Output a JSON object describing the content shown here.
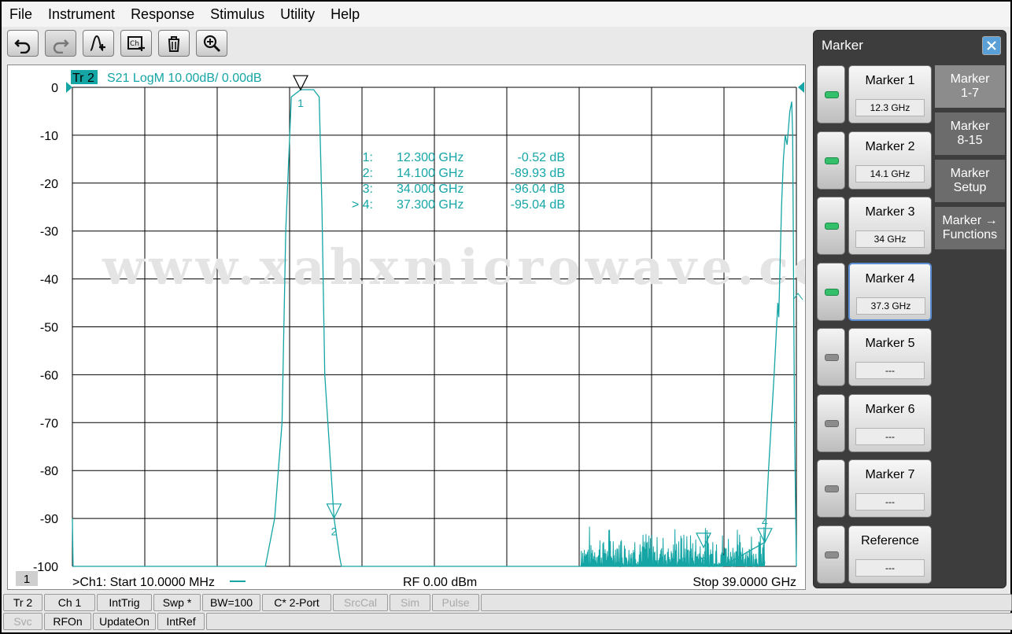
{
  "menu": [
    "File",
    "Instrument",
    "Response",
    "Stimulus",
    "Utility",
    "Help"
  ],
  "toolbar": [
    {
      "name": "undo-button",
      "icon": "undo-icon"
    },
    {
      "name": "redo-button",
      "icon": "redo-icon",
      "disabled": true
    },
    {
      "name": "add-marker-button",
      "icon": "marker-add-icon"
    },
    {
      "name": "add-channel-button",
      "icon": "channel-add-icon"
    },
    {
      "name": "delete-button",
      "icon": "trash-icon"
    },
    {
      "name": "zoom-button",
      "icon": "zoom-in-icon"
    }
  ],
  "trace": {
    "label": "Tr 2",
    "info": "S21 LogM 10.00dB/  0.00dB",
    "color": "#15a5a5"
  },
  "axis": {
    "y_ticks": [
      "0",
      "-10",
      "-20",
      "-30",
      "-40",
      "-50",
      "-60",
      "-70",
      "-80",
      "-90",
      "-100"
    ]
  },
  "chart_data": {
    "type": "line",
    "x_start_ghz": 0.01,
    "x_stop_ghz": 39.0,
    "ylim": [
      -100,
      0
    ],
    "y_step": 10,
    "series": [
      {
        "x": [
          0.01,
          0.05,
          0.1,
          10.4,
          10.9,
          11.3,
          11.5,
          11.8,
          12.3,
          13.0,
          13.3,
          13.45,
          13.6,
          14.1,
          14.4,
          14.5,
          27.4,
          35.0,
          37.3,
          37.5,
          37.8,
          38.0,
          38.05,
          38.2,
          38.3,
          38.4,
          38.5,
          38.65,
          38.75,
          38.8,
          38.9,
          39.0
        ],
        "y": [
          -90,
          -100,
          -100,
          -100,
          -90,
          -70,
          -30,
          -2,
          -0.5,
          -0.5,
          -2,
          -25,
          -60,
          -90,
          -98,
          -100,
          -100,
          -100,
          -95,
          -80,
          -60,
          -45,
          -48,
          -25,
          -15,
          -10,
          -12,
          -5,
          -3,
          -10,
          -70,
          -100
        ]
      }
    ],
    "noise_floor": {
      "x_from_ghz": 27.4,
      "x_to_ghz": 37.3,
      "min_db": -100,
      "max_db": -91
    }
  },
  "markers": [
    {
      "num": "1",
      "freq": "12.300  GHz",
      "val": "-0.52 dB",
      "x_ghz": 12.3,
      "y_db": -0.52,
      "active": false
    },
    {
      "num": "2",
      "freq": "14.100  GHz",
      "val": "-89.93 dB",
      "x_ghz": 14.1,
      "y_db": -89.93,
      "active": false
    },
    {
      "num": "3",
      "freq": "34.000  GHz",
      "val": "-96.04 dB",
      "x_ghz": 34.0,
      "y_db": -96.04,
      "active": false
    },
    {
      "num": "4",
      "freq": "37.300  GHz",
      "val": "-95.04 dB",
      "x_ghz": 37.3,
      "y_db": -95.04,
      "active": true
    }
  ],
  "marker_readout_prefix": [
    "1:",
    "2:",
    "3:",
    "> 4:"
  ],
  "watermark": "www.xahxmicrowave.com",
  "footer": {
    "channel_badge": "1",
    "start": ">Ch1:  Start   10.0000 MHz",
    "power": "RF     0.00 dBm",
    "stop": "Stop  39.0000 GHz"
  },
  "status_row1": [
    {
      "label": "Tr 2",
      "w": 50
    },
    {
      "label": "Ch 1",
      "w": 65
    },
    {
      "label": "IntTrig",
      "w": 70
    },
    {
      "label": "Swp *",
      "w": 60
    },
    {
      "label": "BW=100",
      "w": 74
    },
    {
      "label": "C* 2-Port",
      "w": 88
    },
    {
      "label": "SrcCal",
      "w": 70,
      "dim": true
    },
    {
      "label": "Sim",
      "w": 52,
      "dim": true
    },
    {
      "label": "Pulse",
      "w": 60,
      "dim": true
    },
    {
      "label": "",
      "w": 675
    }
  ],
  "status_row2": [
    {
      "label": "Svc",
      "w": 50,
      "dim": true
    },
    {
      "label": "RFOn",
      "w": 60
    },
    {
      "label": "UpdateOn",
      "w": 80
    },
    {
      "label": "IntRef",
      "w": 60
    },
    {
      "label": "",
      "w": 1026
    }
  ],
  "marker_panel": {
    "title": "Marker",
    "buttons": [
      {
        "title": "Marker 1",
        "value": "12.3 GHz",
        "on": true
      },
      {
        "title": "Marker 2",
        "value": "14.1 GHz",
        "on": true
      },
      {
        "title": "Marker 3",
        "value": "34 GHz",
        "on": true
      },
      {
        "title": "Marker 4",
        "value": "37.3 GHz",
        "on": true,
        "selected": true
      },
      {
        "title": "Marker 5",
        "value": "---",
        "on": false
      },
      {
        "title": "Marker 6",
        "value": "---",
        "on": false
      },
      {
        "title": "Marker 7",
        "value": "---",
        "on": false
      },
      {
        "title": "Reference",
        "value": "---",
        "on": false
      }
    ],
    "tabs": [
      {
        "label": "Marker\n1-7",
        "active": true
      },
      {
        "label": "Marker\n8-15"
      },
      {
        "label": "Marker\nSetup"
      },
      {
        "label": "Marker →\nFunctions"
      }
    ]
  }
}
